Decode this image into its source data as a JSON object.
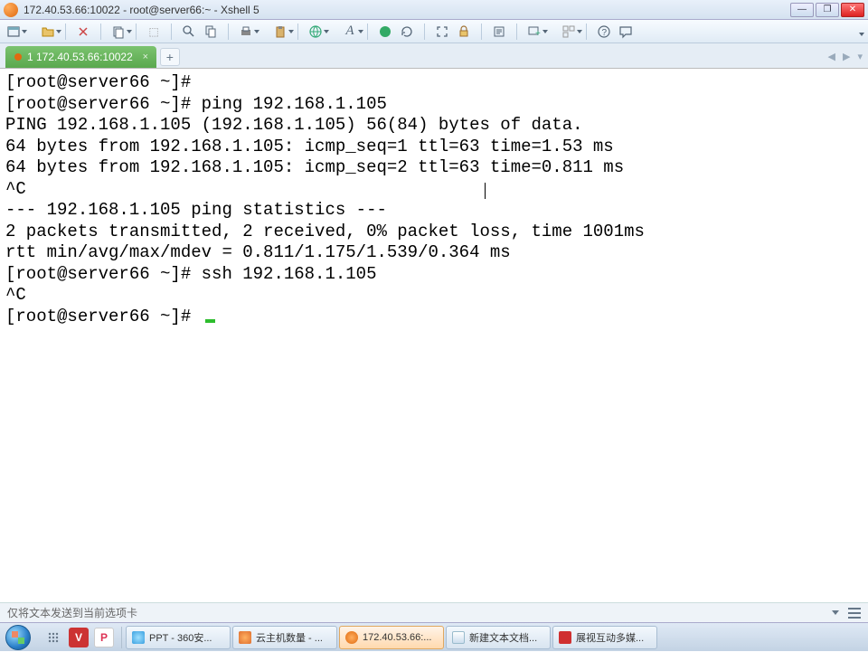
{
  "window": {
    "title": "172.40.53.66:10022 - root@server66:~ - Xshell 5"
  },
  "tabs": {
    "active": "1 172.40.53.66:10022"
  },
  "terminal": {
    "lines": [
      "[root@server66 ~]#",
      "[root@server66 ~]# ping 192.168.1.105",
      "PING 192.168.1.105 (192.168.1.105) 56(84) bytes of data.",
      "64 bytes from 192.168.1.105: icmp_seq=1 ttl=63 time=1.53 ms",
      "64 bytes from 192.168.1.105: icmp_seq=2 ttl=63 time=0.811 ms",
      "^C",
      "--- 192.168.1.105 ping statistics ---",
      "2 packets transmitted, 2 received, 0% packet loss, time 1001ms",
      "rtt min/avg/max/mdev = 0.811/1.175/1.539/0.364 ms",
      "[root@server66 ~]# ssh 192.168.1.105",
      "^C",
      "[root@server66 ~]# "
    ]
  },
  "statusbar": {
    "text": "仅将文本发送到当前选项卡"
  },
  "taskbar": {
    "items": [
      {
        "label": "PPT - 360安...",
        "icon_color": "#3aa0e0"
      },
      {
        "label": "云主机数量 - ...",
        "icon_color": "#e07030"
      },
      {
        "label": "172.40.53.66:...",
        "icon_color": "#e06a10",
        "active": true
      },
      {
        "label": "新建文本文档...",
        "icon_color": "#4aa0d0"
      },
      {
        "label": "展视互动多媒...",
        "icon_color": "#d03030"
      }
    ]
  }
}
